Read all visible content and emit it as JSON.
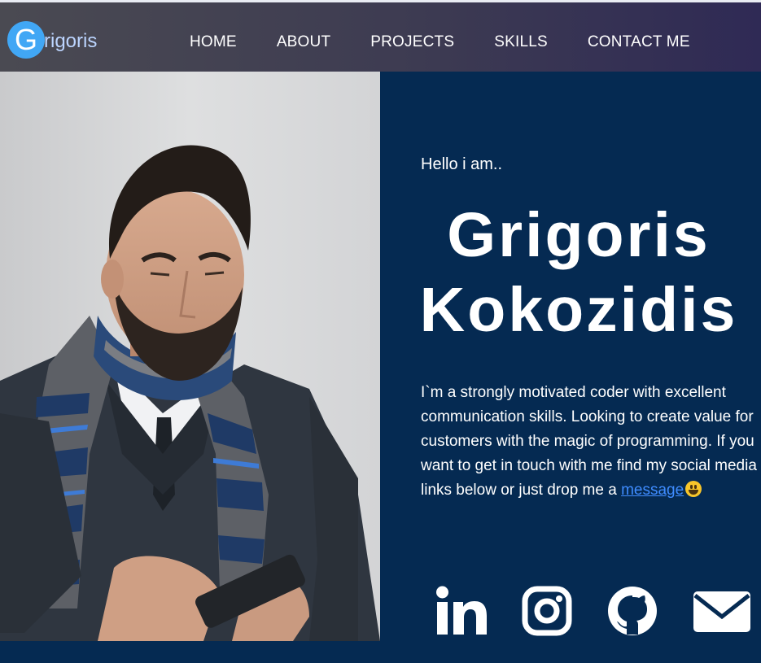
{
  "logo": {
    "letter": "G",
    "text": "rigoris"
  },
  "nav": [
    "HOME",
    "ABOUT",
    "PROJECTS",
    "SKILLS",
    "CONTACT ME"
  ],
  "hero": {
    "greeting": "Hello i am..",
    "first_name": "Grigoris",
    "last_name": "Kokozidis",
    "bio_text": "I`m a strongly motivated coder with excellent communication skills. Looking to create value for customers with the magic of programming. If you want to get in touch with me find my social media links below or just drop me a ",
    "bio_link": "message",
    "emoji": "grinning-face-emoji"
  },
  "socials": [
    "linkedin-icon",
    "instagram-icon",
    "github-icon",
    "email-icon"
  ],
  "colors": {
    "background": "#052a52",
    "navbar": "#3f3d52",
    "logo_circle": "#41a7f5",
    "link": "#3f8cff",
    "text": "#ffffff"
  }
}
